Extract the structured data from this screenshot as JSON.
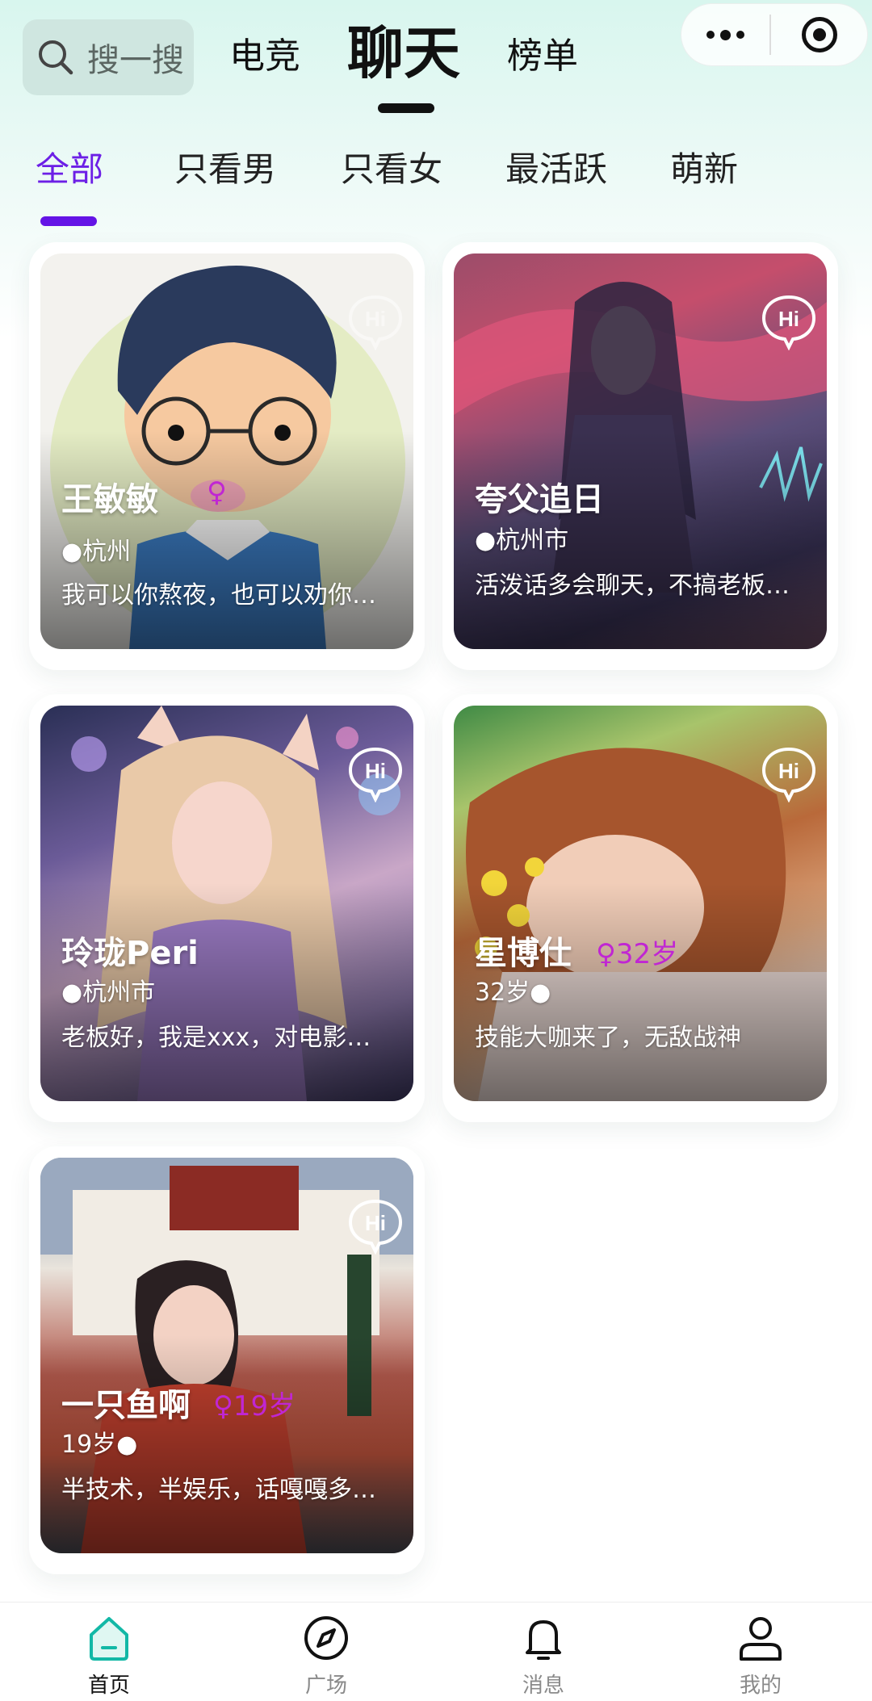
{
  "header": {
    "search_label": "搜一搜",
    "tabs": [
      "电竞",
      "聊天",
      "榜单"
    ],
    "active_tab": "聊天"
  },
  "filters": {
    "items": [
      "全部",
      "只看男",
      "只看女",
      "最活跃",
      "萌新"
    ],
    "active": "全部"
  },
  "cards": [
    {
      "name": "王敏敏",
      "gender": "♀",
      "location": "●杭州",
      "desc": "我可以你熬夜，也可以劝你…",
      "hi_label": "Hi"
    },
    {
      "name": "夸父追日",
      "gender": "",
      "location": "●杭州市",
      "desc": "活泼话多会聊天，不搞老板…",
      "hi_label": "Hi"
    },
    {
      "name": "玲珑Peri",
      "gender": "",
      "location": "●杭州市",
      "desc": "老板好，我是xxx，对电影和…",
      "hi_label": "Hi"
    },
    {
      "name": "星博仕",
      "gender": "♀32岁",
      "location": "32岁●",
      "desc": "技能大咖来了，无敌战神",
      "hi_label": "Hi"
    },
    {
      "name": "一只鱼啊",
      "gender": "♀19岁",
      "location": "19岁●",
      "desc": "半技术，半娱乐，话嘎嘎多…",
      "hi_label": "Hi"
    }
  ],
  "tabbar": {
    "items": [
      {
        "label": "首页",
        "icon": "home-icon",
        "active": true
      },
      {
        "label": "广场",
        "icon": "compass-icon",
        "active": false
      },
      {
        "label": "消息",
        "icon": "bell-icon",
        "active": false
      },
      {
        "label": "我的",
        "icon": "user-icon",
        "active": false
      }
    ]
  },
  "colors": {
    "accent": "#6414e6",
    "home_active": "#12b8a6",
    "gender": "#c026d3"
  }
}
